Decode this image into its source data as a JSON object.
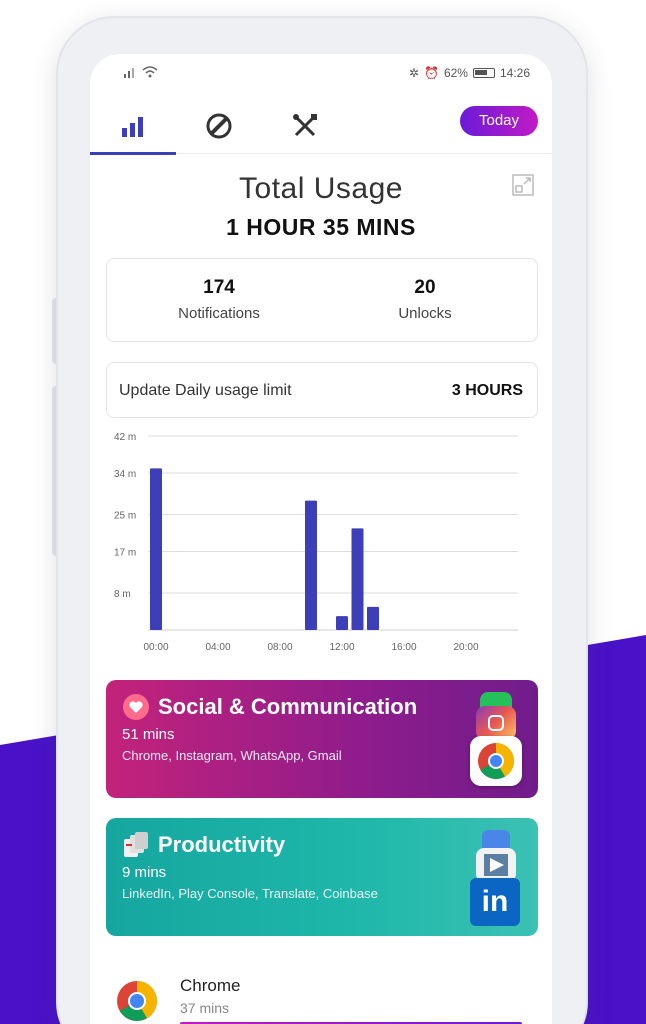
{
  "status_bar": {
    "battery": "62%",
    "time": "14:26"
  },
  "tabs": [
    {
      "id": "usage",
      "icon": "bar-chart-icon",
      "active": true
    },
    {
      "id": "block",
      "icon": "block-icon",
      "active": false
    },
    {
      "id": "tools",
      "icon": "tools-icon",
      "active": false
    }
  ],
  "today_button": "Today",
  "header": {
    "title": "Total Usage",
    "total": "1 HOUR 35 MINS"
  },
  "stats": {
    "notifications": {
      "value": "174",
      "label": "Notifications"
    },
    "unlocks": {
      "value": "20",
      "label": "Unlocks"
    }
  },
  "limit": {
    "label": "Update Daily usage limit",
    "value": "3 HOURS"
  },
  "chart_data": {
    "type": "bar",
    "y_ticks": [
      "8 m",
      "17 m",
      "25 m",
      "34 m",
      "42 m"
    ],
    "y_tick_values": [
      8,
      17,
      25,
      34,
      42
    ],
    "ylim": [
      0,
      42
    ],
    "x_ticks": [
      "00:00",
      "04:00",
      "08:00",
      "12:00",
      "16:00",
      "20:00"
    ],
    "x_tick_hours": [
      0,
      4,
      8,
      12,
      16,
      20
    ],
    "bars": [
      {
        "hour": 0,
        "value": 35
      },
      {
        "hour": 10,
        "value": 28
      },
      {
        "hour": 12,
        "value": 3
      },
      {
        "hour": 13,
        "value": 22
      },
      {
        "hour": 14,
        "value": 5
      }
    ],
    "color": "#3d3fb8",
    "grid": true
  },
  "categories": [
    {
      "title": "Social & Communication",
      "time": "51 mins",
      "apps": "Chrome, Instagram, WhatsApp, Gmail",
      "icon": "heart-icon",
      "app_icons": [
        "whatsapp-icon",
        "instagram-icon",
        "chrome-icon"
      ]
    },
    {
      "title": "Productivity",
      "time": "9 mins",
      "apps": "LinkedIn, Play Console, Translate, Coinbase",
      "icon": "docs-icon",
      "app_icons": [
        "translate-icon",
        "play-console-icon",
        "linkedin-icon"
      ]
    }
  ],
  "app_list": [
    {
      "name": "Chrome",
      "time": "37 mins",
      "icon": "chrome-icon"
    }
  ],
  "colors": {
    "accent": "#3d3fb8",
    "social_start": "#c3237a",
    "social_end": "#701d8b",
    "productivity": "#1fb8aa",
    "purple_bg": "#4a12c8"
  }
}
